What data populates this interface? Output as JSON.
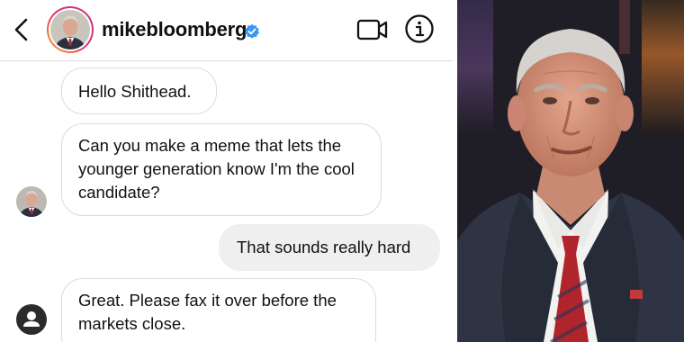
{
  "header": {
    "username": "mikebloomberg",
    "verified": true,
    "icons": [
      "back-chevron-icon",
      "video-camera-icon",
      "info-icon",
      "verified-badge-icon"
    ]
  },
  "messages": [
    {
      "direction": "incoming",
      "text": "Hello Shithead."
    },
    {
      "direction": "incoming",
      "text": "Can you make a meme that lets the younger generation know I'm the cool candidate?"
    },
    {
      "direction": "outgoing",
      "text": "That sounds really hard"
    },
    {
      "direction": "incoming",
      "text": "Great. Please fax it over before the markets close."
    }
  ],
  "colors": {
    "verified_blue": "#3897f0",
    "incoming_border": "#dbdbdb",
    "outgoing_bg": "#efefef",
    "tie_red": "#b0252b",
    "photo_bg": "#1e1d25"
  }
}
